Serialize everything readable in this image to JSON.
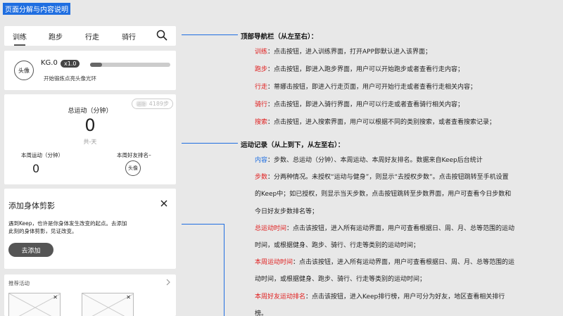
{
  "page_title": "页面分解与内容说明",
  "nav": {
    "items": [
      "训练",
      "跑步",
      "行走",
      "骑行"
    ],
    "active_index": 0
  },
  "profile": {
    "avatar_label": "头像",
    "level": "KG.0",
    "level_badge": "x1.0",
    "progress": 0.15,
    "hint": "开始锻炼点亮头像光环"
  },
  "stats": {
    "steps_badge_label": "运动",
    "steps": "4189步",
    "total_label": "总运动（分钟）",
    "total_value": "0",
    "total_period": "共-天",
    "week_label": "本周运动（分钟）",
    "week_value": "0",
    "rank_label": "本周好友排名–",
    "rank_avatar_label": "头像"
  },
  "shadow_card": {
    "title": "添加身体剪影",
    "desc_line1": "遇到Keep，也许是你身体发生改变的起点。去添加",
    "desc_line2": "此刻的身体剪影，见证改变。",
    "button": "去添加"
  },
  "activities": {
    "title": "推荐活动"
  },
  "annotations": {
    "nav_section": {
      "title": "顶部导航栏（从左至右）：",
      "rows": [
        {
          "term": "训练",
          "desc": "：点击按钮，进入训练界面，打开APP即默认进入该界面；"
        },
        {
          "term": "跑步",
          "desc": "：点击按钮，即进入跑步界面，用户可以开始跑步或者查看行走内容；"
        },
        {
          "term": "行走",
          "desc": "：蒂娜击按钮，即进入行走页面，用户可开始行走或者查看行走相关内容；"
        },
        {
          "term": "骑行",
          "desc": "：点击按钮，即进入骑行界面，用户可以行走或者查看骑行相关内容；"
        },
        {
          "term": "搜索",
          "desc": "：点击按钮，进入搜索界面，用户可以根据不同的类别搜索，或者查看搜索记录；"
        }
      ]
    },
    "stats_section": {
      "title": "运动记录（从上到下，从左至右）：",
      "rows": [
        {
          "term": "内容",
          "desc": "：步数、总运动（分钟）、本周运动、本周好友排名。数据来自Keep后台统计"
        },
        {
          "term": "步数",
          "desc": "：分两种情况。未授权“运动与健身”，则显示“去授权步数”。点击按钮跳转至手机设置"
        },
        {
          "term": "",
          "desc": "的Keep中；如已授权，则显示当天步数，点击按钮跳转至步数界面，用户可查看今日步数和"
        },
        {
          "term": "",
          "desc": "今日好友步数排名等；"
        },
        {
          "term": "总运动时间",
          "desc": "：点击该按钮，进入所有运动界面，用户可查看根据日、周、月、总等范围的运动"
        },
        {
          "term": "",
          "desc": "时间，或根据健身、跑步、骑行、行走等类别的运动时间；"
        },
        {
          "term": "本周运动时间",
          "desc": "：点击该按钮，进入所有运动界面，用户可查看根据日、周、月、总等范围的运"
        },
        {
          "term": "",
          "desc": "动时间，或根据健身、跑步、骑行、行走等类别的运动时间；"
        },
        {
          "term": "本周好友运动排名",
          "desc": "：点击该按钮，进入Keep排行榜，用户可分为好友，地区查看相关排行"
        },
        {
          "term": "",
          "desc": "榜。"
        }
      ]
    }
  },
  "colors": {
    "accent_blue": "#1f6ee0",
    "term_red": "#e02020"
  }
}
